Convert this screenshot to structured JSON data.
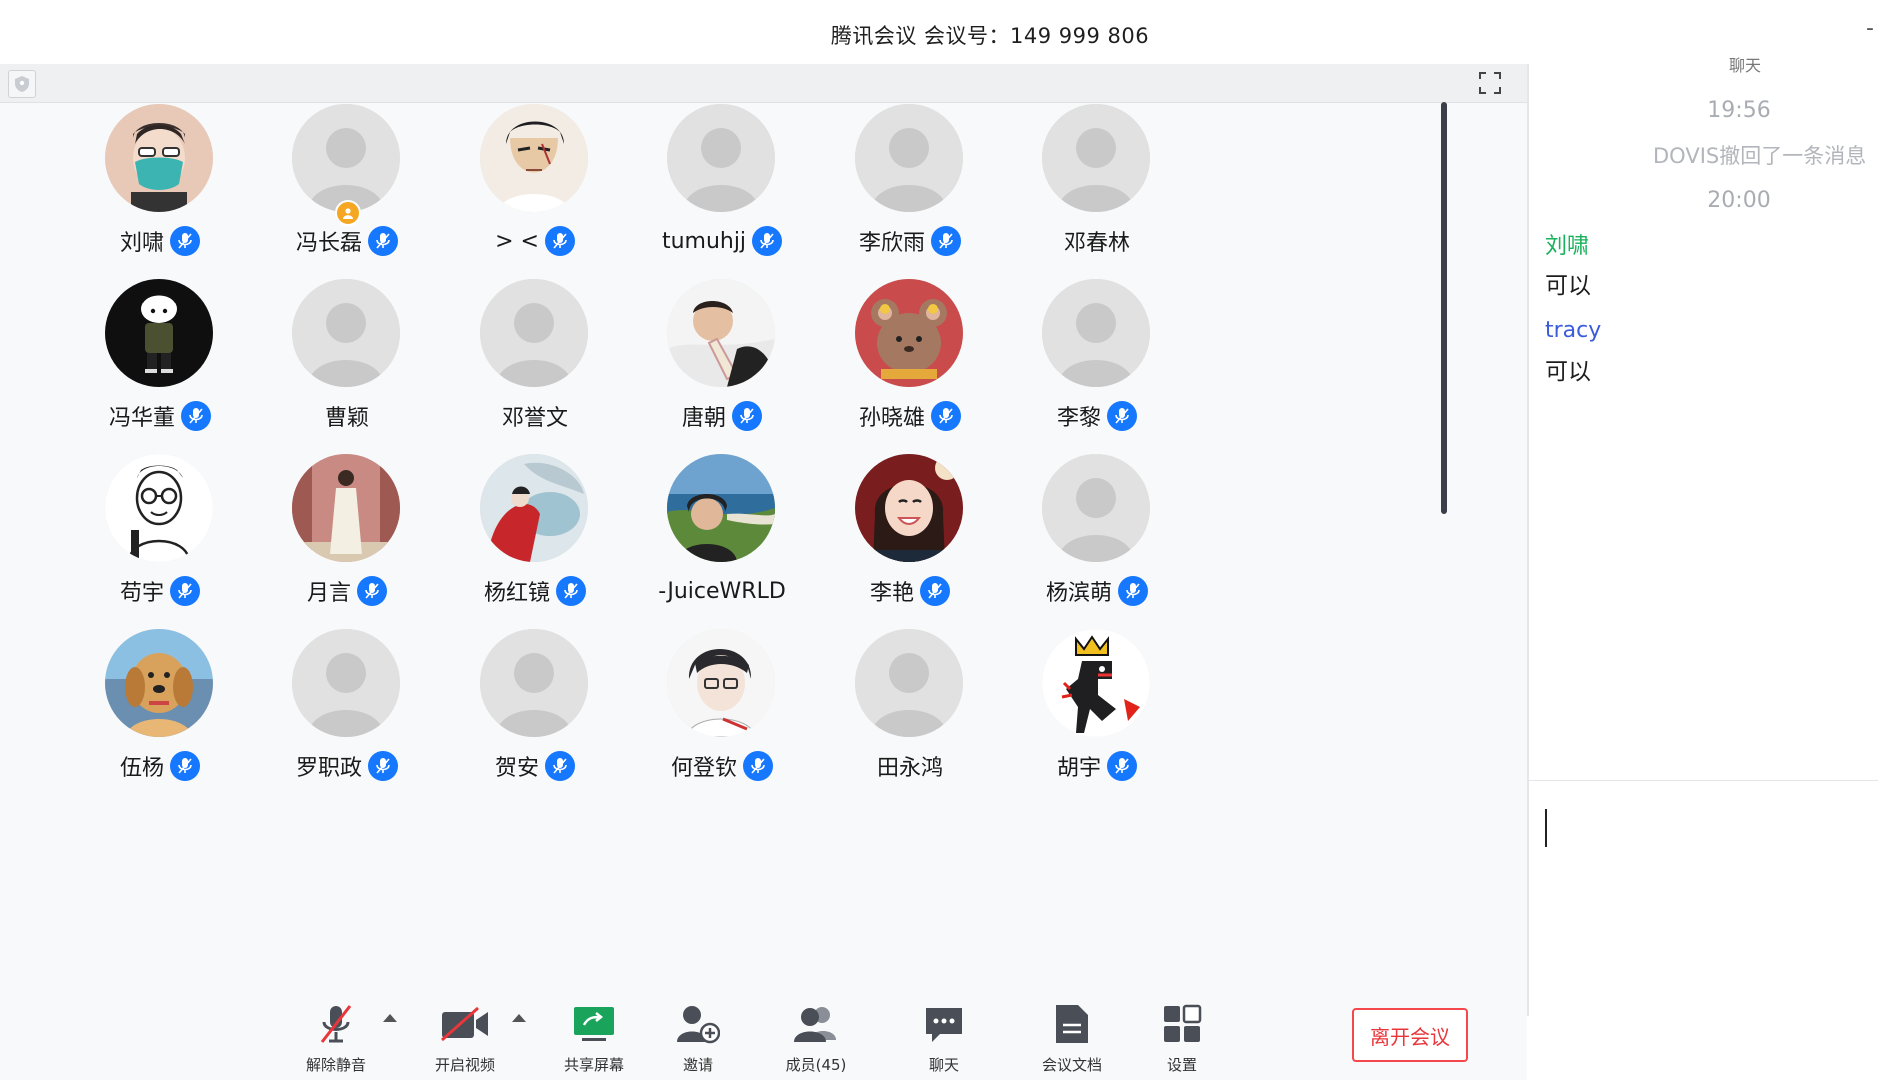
{
  "window": {
    "title": "腾讯会议 会议号：149 999 806",
    "trailing_glyph": "-"
  },
  "participants": [
    {
      "name": "刘啸",
      "avatar": "mask-cartoon",
      "mic": true
    },
    {
      "name": "冯长磊",
      "avatar": "default",
      "mic": true,
      "host": true
    },
    {
      "name": "> <",
      "avatar": "anime-man",
      "mic": true
    },
    {
      "name": "tumuhjj",
      "avatar": "default",
      "mic": true
    },
    {
      "name": "李欣雨",
      "avatar": "default",
      "mic": true
    },
    {
      "name": "邓春林",
      "avatar": "default",
      "mic": false
    },
    {
      "name": "冯华董",
      "avatar": "shinchan-dark",
      "mic": true
    },
    {
      "name": "曹颖",
      "avatar": "default",
      "mic": false
    },
    {
      "name": "邓誉文",
      "avatar": "default",
      "mic": false
    },
    {
      "name": "唐朝",
      "avatar": "baby-photo",
      "mic": true
    },
    {
      "name": "孙晓雄",
      "avatar": "red-mouse",
      "mic": true
    },
    {
      "name": "李黎",
      "avatar": "default",
      "mic": true
    },
    {
      "name": "苟宇",
      "avatar": "sketch-glasses",
      "mic": true
    },
    {
      "name": "月言",
      "avatar": "girl-white-dress",
      "mic": true
    },
    {
      "name": "杨红镜",
      "avatar": "painting-umbrella",
      "mic": true
    },
    {
      "name": "-JuiceWRLD",
      "avatar": "coast-photo",
      "mic": false
    },
    {
      "name": "李艳",
      "avatar": "girl-smile",
      "mic": true
    },
    {
      "name": "杨滨萌",
      "avatar": "default",
      "mic": true
    },
    {
      "name": "伍杨",
      "avatar": "golden-dog",
      "mic": true
    },
    {
      "name": "罗职政",
      "avatar": "default",
      "mic": true
    },
    {
      "name": "贺安",
      "avatar": "default",
      "mic": true
    },
    {
      "name": "何登钦",
      "avatar": "anime-boy",
      "mic": true
    },
    {
      "name": "田永鸿",
      "avatar": "default",
      "mic": false
    },
    {
      "name": "胡宇",
      "avatar": "crown-dino",
      "mic": true
    }
  ],
  "toolbar": {
    "unmute": "解除静音",
    "start_video": "开启视频",
    "share_screen": "共享屏幕",
    "invite": "邀请",
    "members": "成员(45)",
    "chat": "聊天",
    "docs": "会议文档",
    "settings": "设置",
    "leave": "离开会议"
  },
  "chat": {
    "peek_title": "聊天",
    "time1": "19:56",
    "system_msg": "DOVIS撤回了一条消息",
    "time2": "20:00",
    "messages": [
      {
        "sender": "刘啸",
        "text": "可以",
        "color": "#19b15b"
      },
      {
        "sender": "tracy",
        "text": "可以",
        "color": "#3b5bdb"
      }
    ]
  },
  "colors": {
    "accent_blue": "#1677ff",
    "leave_red": "#e8363b",
    "share_green": "#19a35b",
    "host_orange": "#f5a623"
  }
}
